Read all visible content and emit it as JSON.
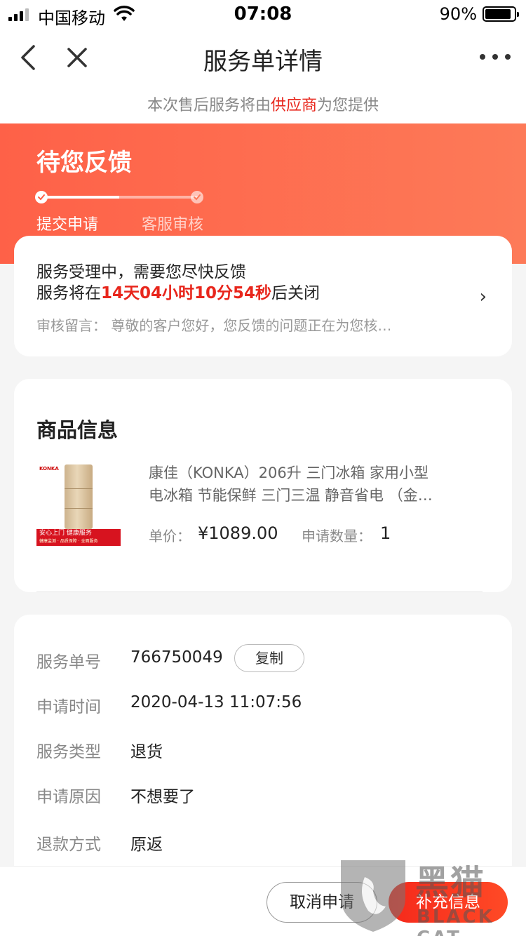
{
  "status_bar": {
    "carrier": "中国移动",
    "time": "07:08",
    "battery": "90%",
    "battery_level": 0.9
  },
  "nav": {
    "title": "服务单详情"
  },
  "supplier": {
    "prefix": "本次售后服务将由",
    "highlight": "供应商",
    "suffix": "为您提供"
  },
  "banner": {
    "title": "待您反馈",
    "progress": 0.5,
    "steps": [
      {
        "label": "提交申请"
      },
      {
        "label": "客服审核"
      }
    ]
  },
  "status_card": {
    "line1": "服务受理中，需要您尽快反馈",
    "line2_prefix": "服务将在",
    "countdown": "14天04小时10分54秒",
    "line2_suffix": "后关闭",
    "note": "审核留言：  尊敬的客户您好，您反馈的问题正在为您核…"
  },
  "product": {
    "section_title": "商品信息",
    "image_brand": "KONKA",
    "image_banner": "安心上门  健康服务",
    "image_banner_sub": "健康监测 · 品质保障 · 全面服务",
    "name_line1": "康佳（KONKA）206升 三门冰箱 家用小型",
    "name_line2": "电冰箱 节能保鲜 三门三温 静音省电 （金…",
    "price_label": "单价：",
    "price": "¥1089.00",
    "qty_label": "申请数量：",
    "qty": "1"
  },
  "details": {
    "order_no_label": "服务单号",
    "order_no": "766750049",
    "copy_label": "复制",
    "apply_time_label": "申请时间",
    "apply_time": "2020-04-13 11:07:56",
    "service_type_label": "服务类型",
    "service_type": "退货",
    "reason_label": "申请原因",
    "reason": "不想要了",
    "refund_label": "退款方式",
    "refund": "原返"
  },
  "actions": {
    "cancel": "取消申请",
    "supplement": "补充信息"
  },
  "watermark": {
    "text": "黑猫",
    "sub": "BLACK CAT"
  },
  "colors": {
    "accent": "#e8261c",
    "banner_start": "#fe6148",
    "banner_end": "#fd7a58"
  }
}
